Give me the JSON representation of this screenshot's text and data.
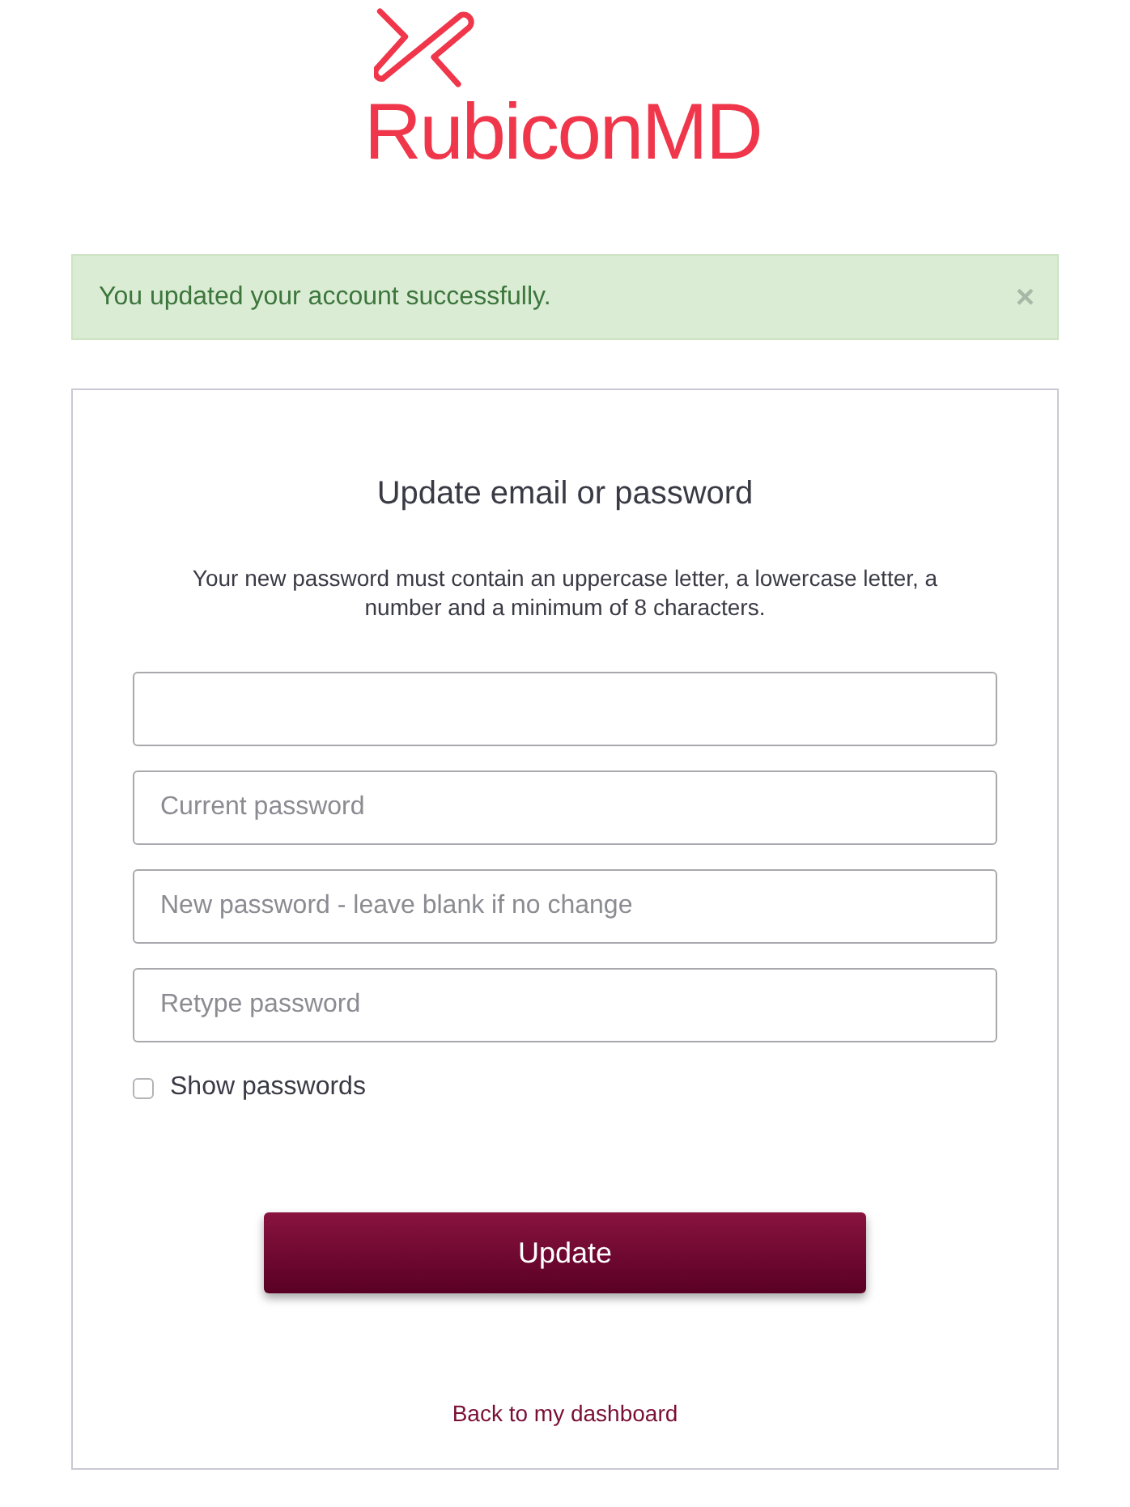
{
  "logo": {
    "wordmark": "RubiconMD"
  },
  "alert": {
    "message": "You updated your account successfully.",
    "close": "×"
  },
  "form": {
    "title": "Update email or password",
    "description": "Your new password must contain an uppercase letter, a lowercase letter, a number and a minimum of 8 characters.",
    "password_fields": [
      {
        "placeholder": "Current password"
      },
      {
        "placeholder": "New password - leave blank if no change"
      },
      {
        "placeholder": "Retype password"
      }
    ],
    "show_passwords": {
      "label": "Show passwords",
      "checked": false
    },
    "submit": {
      "label": "Update"
    },
    "back_link": {
      "label": "Back to my dashboard"
    }
  }
}
